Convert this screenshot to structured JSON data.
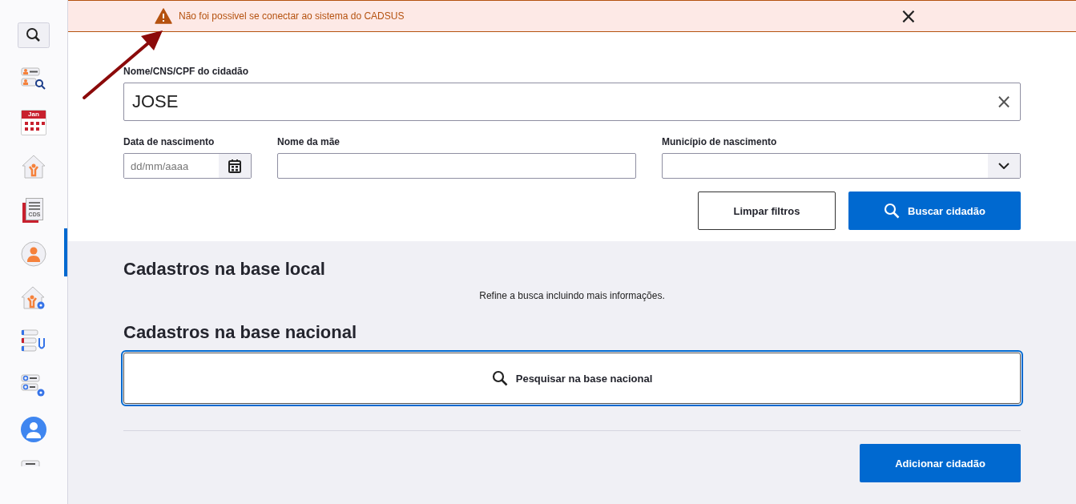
{
  "sidebar": {
    "items": [
      {
        "kind": "search",
        "selected": false
      },
      {
        "kind": "person-search",
        "selected": false
      },
      {
        "kind": "calendar",
        "text": "Jan",
        "selected": false
      },
      {
        "kind": "house",
        "selected": false
      },
      {
        "kind": "cds",
        "text": "CDS",
        "selected": false
      },
      {
        "kind": "person",
        "selected": true
      },
      {
        "kind": "house-gear",
        "selected": false
      },
      {
        "kind": "list-stethoscope",
        "selected": false
      },
      {
        "kind": "list-gear",
        "selected": false
      },
      {
        "kind": "doctor",
        "selected": false
      },
      {
        "kind": "list",
        "selected": false
      }
    ]
  },
  "alert": {
    "message": "Não foi possivel se conectar ao sistema do CADSUS",
    "close": "×"
  },
  "search": {
    "label": "Nome/CNS/CPF do cidadão",
    "value": "JOSE",
    "clear": "×"
  },
  "filters": [
    {
      "kind": "date",
      "label": "Data de nascimento",
      "placeholder": "dd/mm/aaaa"
    },
    {
      "kind": "text",
      "label": "Nome da mãe"
    },
    {
      "kind": "select",
      "label": "Município de nascimento"
    }
  ],
  "buttons": {
    "clear": "Limpar filtros",
    "search": "Buscar cidadão"
  },
  "local": {
    "title": "Cadastros na base local",
    "message": "Refine a busca incluindo mais informações."
  },
  "national": {
    "title": "Cadastros na base nacional",
    "button": "Pesquisar na base nacional"
  },
  "add_button": "Adicionar cidadão"
}
